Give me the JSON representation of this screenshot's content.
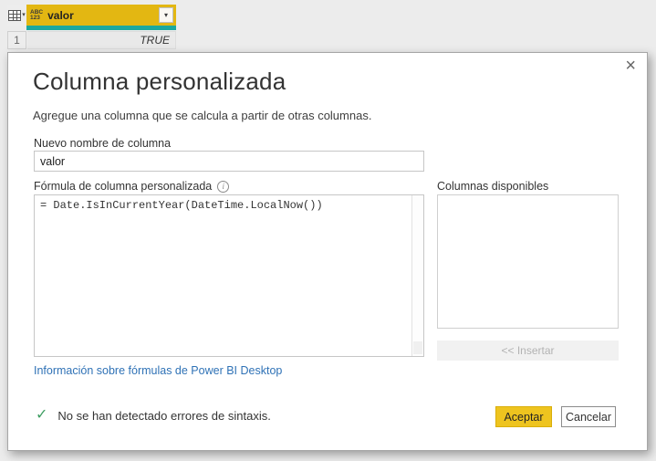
{
  "colors": {
    "column_header_gold": "#e3b712",
    "teal_accent": "#1ca89e",
    "ok_button_gold": "#eec41f",
    "link_blue": "#2f72b6",
    "check_green": "#3f9e63",
    "page_background": "#ececec"
  },
  "grid": {
    "corner_caret": "▾",
    "column": {
      "type_icon_line1": "ABC",
      "type_icon_line2": "123",
      "name": "valor",
      "filter_caret": "▾"
    },
    "row": {
      "num": "1",
      "value": "TRUE"
    }
  },
  "dialog": {
    "close_icon": "×",
    "title": "Columna personalizada",
    "subtitle": "Agregue una columna que se calcula a partir de otras columnas.",
    "name_label": "Nuevo nombre de columna",
    "name_value": "valor",
    "formula_label": "Fórmula de columna personalizada",
    "info_icon_glyph": "i",
    "formula": "= Date.IsInCurrentYear(DateTime.LocalNow())",
    "available_columns_label": "Columnas disponibles",
    "insert_button_label": "<< Insertar",
    "link_label": "Información sobre fórmulas de Power BI Desktop",
    "status": {
      "icon": "✓",
      "message": "No se han detectado errores de sintaxis."
    },
    "ok_label": "Aceptar",
    "cancel_label": "Cancelar"
  }
}
